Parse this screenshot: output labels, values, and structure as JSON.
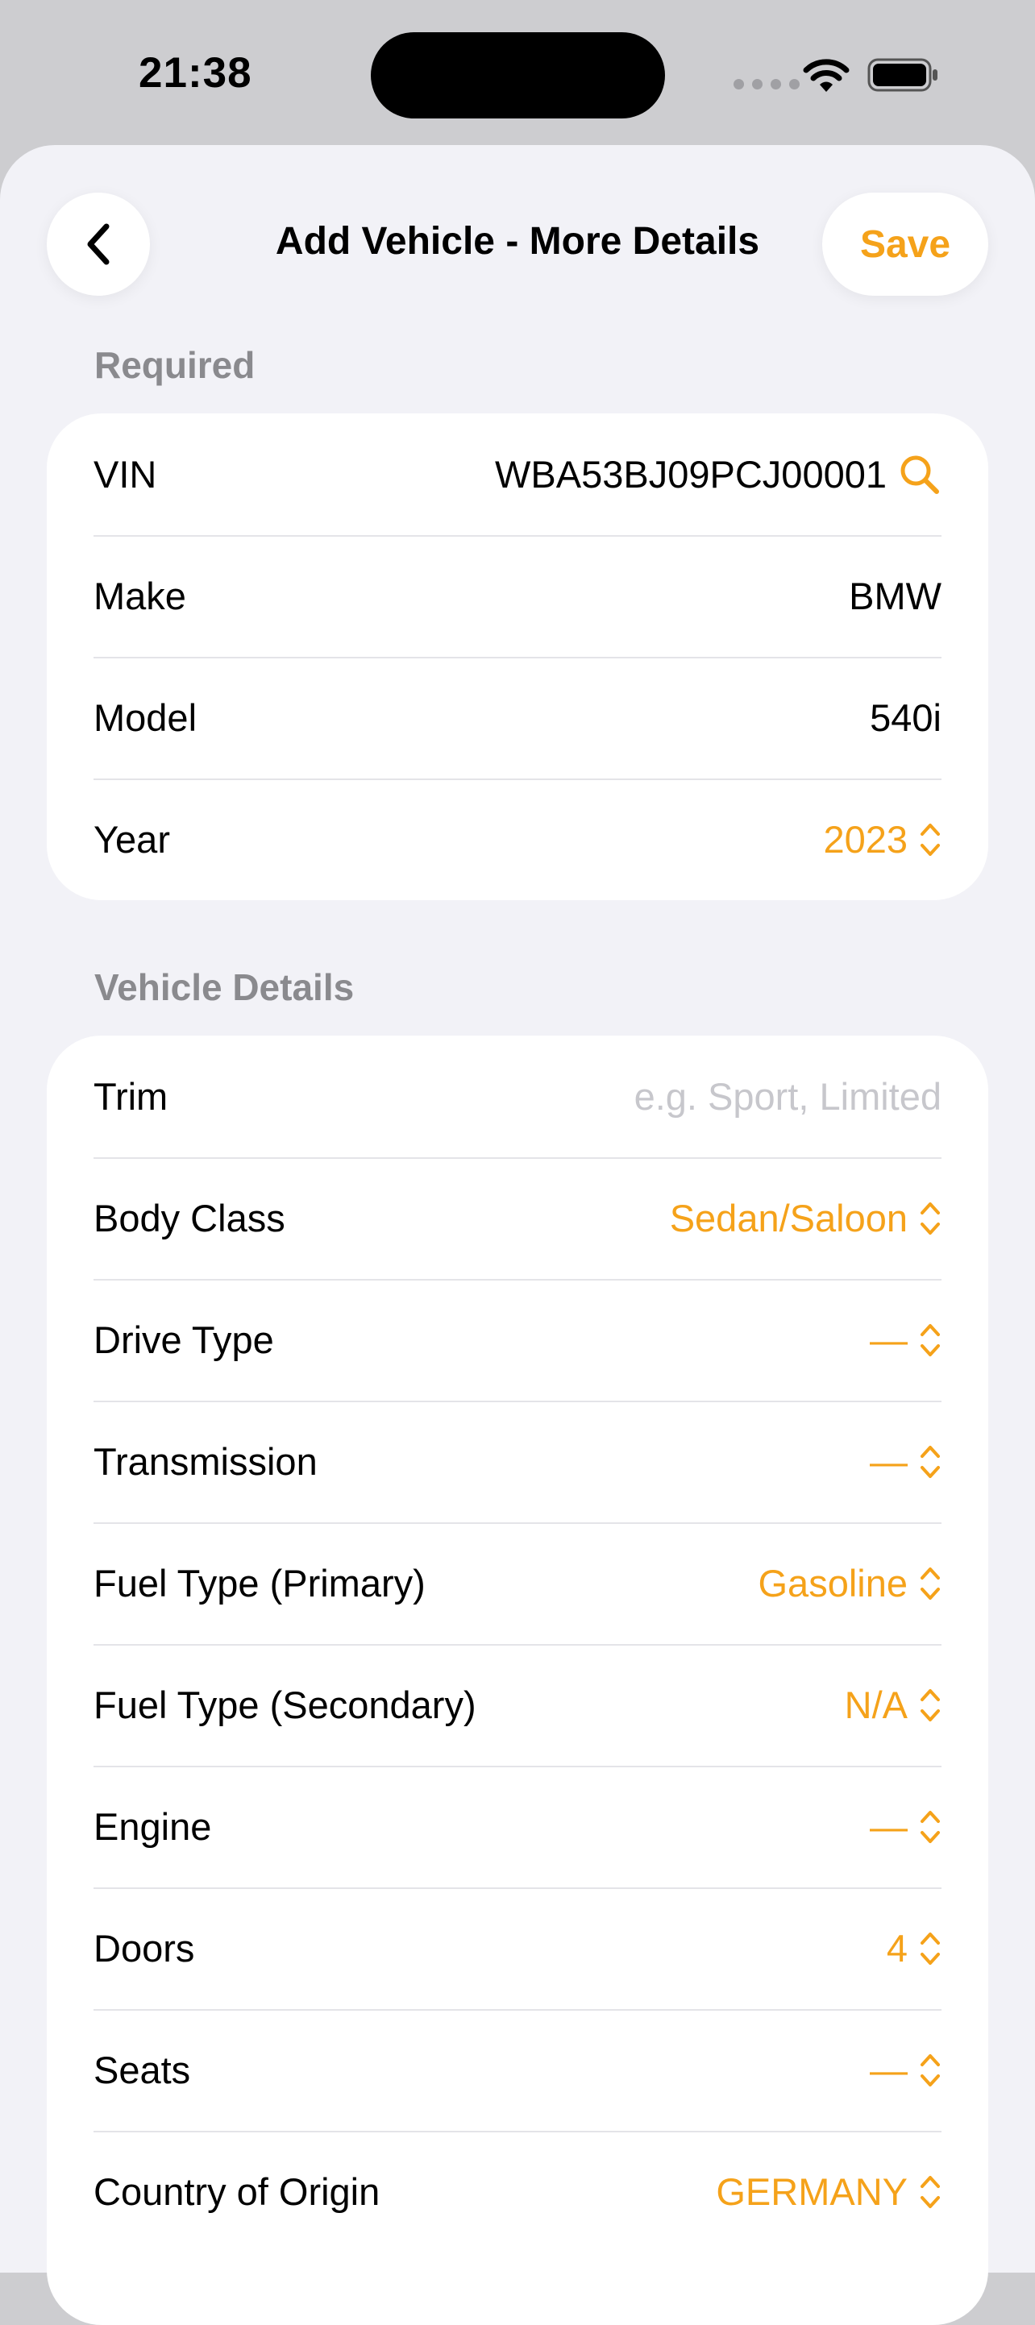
{
  "status_bar": {
    "time": "21:38"
  },
  "nav": {
    "title": "Add Vehicle - More Details",
    "save_label": "Save"
  },
  "colors": {
    "accent": "#f5a21a",
    "background": "#f2f2f7",
    "card": "#ffffff",
    "secondary_text": "#8a8a8e"
  },
  "required": {
    "header": "Required",
    "rows": [
      {
        "label": "VIN",
        "value": "WBA53BJ09PCJ00001",
        "icon": "search-icon"
      },
      {
        "label": "Make",
        "value": "BMW"
      },
      {
        "label": "Model",
        "value": "540i"
      },
      {
        "label": "Year",
        "value": "2023",
        "icon": "chevron-up-down-icon"
      }
    ]
  },
  "details": {
    "header": "Vehicle Details",
    "trim": {
      "label": "Trim",
      "placeholder": "e.g. Sport, Limited"
    },
    "rows": [
      {
        "label": "Body Class",
        "value": "Sedan/Saloon"
      },
      {
        "label": "Drive Type",
        "value": "—"
      },
      {
        "label": "Transmission",
        "value": "—"
      },
      {
        "label": "Fuel Type (Primary)",
        "value": "Gasoline"
      },
      {
        "label": "Fuel Type (Secondary)",
        "value": "N/A"
      },
      {
        "label": "Engine",
        "value": "—"
      },
      {
        "label": "Doors",
        "value": "4"
      },
      {
        "label": "Seats",
        "value": "—"
      },
      {
        "label": "Country of Origin",
        "value": "GERMANY"
      }
    ]
  }
}
